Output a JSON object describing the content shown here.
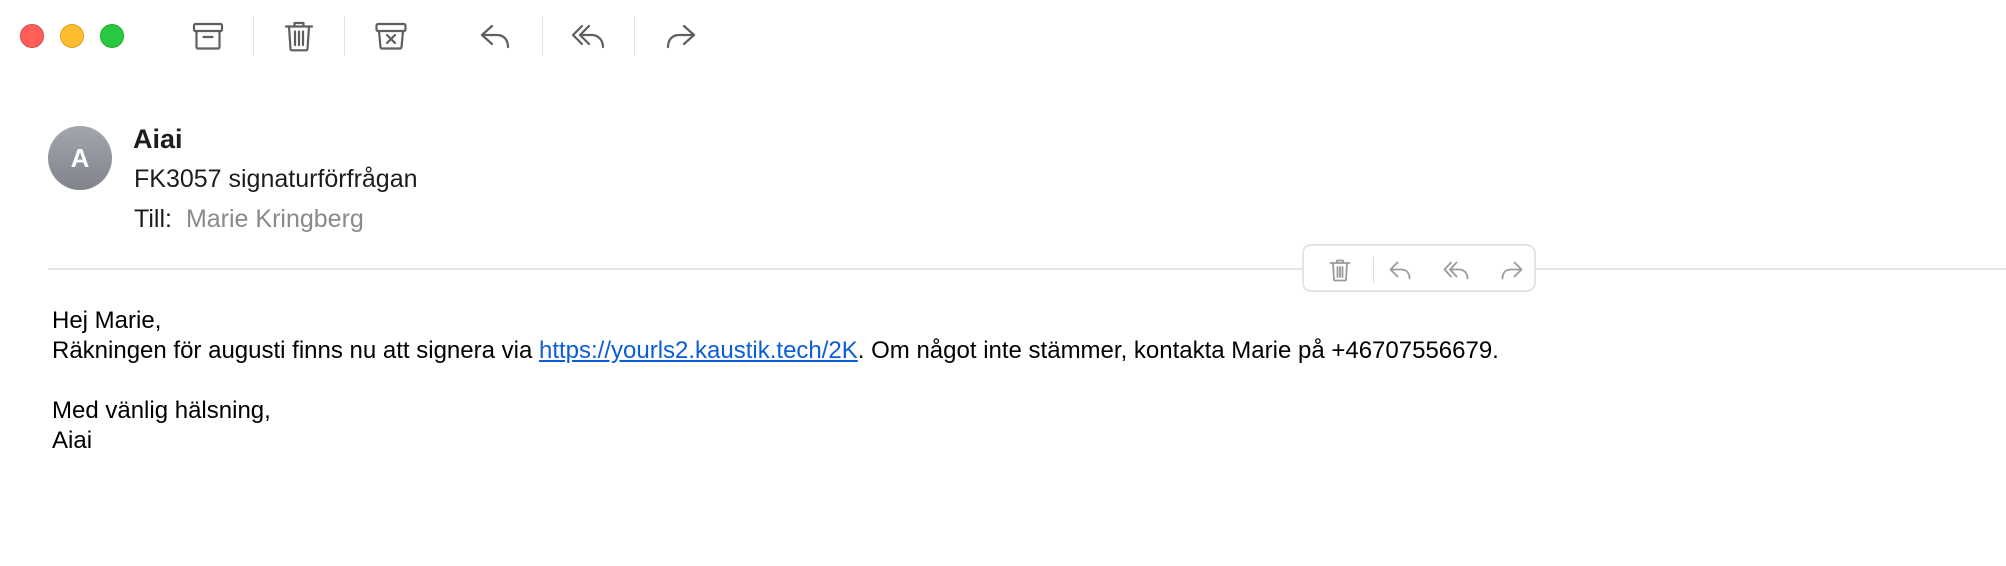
{
  "toolbar": {
    "window_controls": [
      "close",
      "minimize",
      "zoom"
    ],
    "actions": [
      {
        "name": "archive",
        "icon": "archive-icon"
      },
      {
        "name": "delete",
        "icon": "trash-icon"
      },
      {
        "name": "junk",
        "icon": "junk-icon"
      },
      {
        "name": "reply",
        "icon": "reply-icon"
      },
      {
        "name": "reply-all",
        "icon": "reply-all-icon"
      },
      {
        "name": "forward",
        "icon": "forward-icon"
      }
    ]
  },
  "message": {
    "avatar_initial": "A",
    "sender": "Aiai",
    "subject": "FK3057 signaturförfrågan",
    "to_label": "Till:",
    "to_value": "Marie Kringberg",
    "inline_actions": [
      "trash-icon",
      "reply-icon",
      "reply-all-icon",
      "forward-icon"
    ],
    "body": {
      "greeting": "Hej Marie,",
      "line_before_link": "Räkningen för augusti finns nu att signera via ",
      "link_text": "https://yourls2.kaustik.tech/2K",
      "line_after_link": ". Om något inte stämmer, kontakta Marie på +46707556679.",
      "closing": "Med vänlig hälsning,",
      "signature": "Aiai"
    }
  },
  "colors": {
    "close": "#ff5f57",
    "minimize": "#febc2e",
    "zoom": "#28c840",
    "link": "#0a5ed7",
    "muted_text": "#8a8a8e",
    "icon": "#5f5f63"
  }
}
